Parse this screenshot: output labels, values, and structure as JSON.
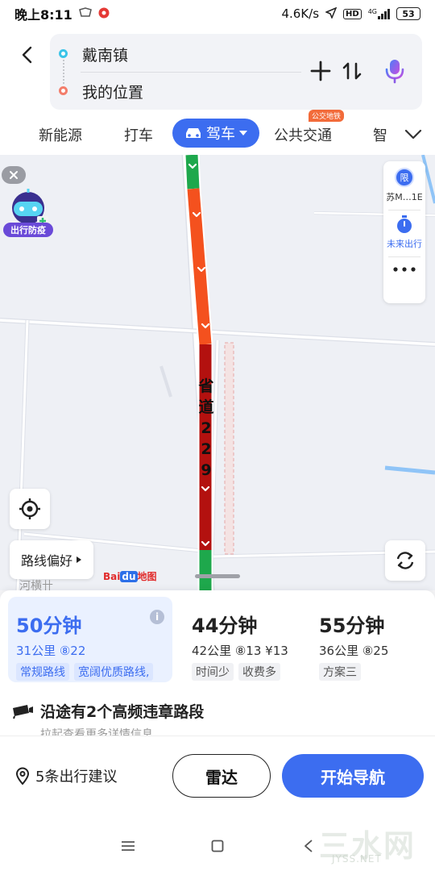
{
  "status_bar": {
    "time": "晚上8:11",
    "network_speed": "4.6K/s",
    "hd_badge": "HD",
    "network_type": "4G",
    "battery": "53"
  },
  "header": {
    "origin": "戴南镇",
    "destination": "我的位置",
    "icons": [
      "back-icon",
      "plus-icon",
      "swap-icon",
      "microphone-icon"
    ]
  },
  "tabs": {
    "new_energy": "新能源",
    "taxi": "打车",
    "drive": "驾车",
    "transit": "公共交通",
    "transit_badge": "公交地铁",
    "smart": "智"
  },
  "map": {
    "mascot_label": "出行防疫",
    "plate_label": "苏M…1E",
    "plate_icon_text": "限",
    "future_trip_label": "未来出行",
    "route_preference_label": "路线偏好",
    "road_name": [
      "省",
      "道",
      "2",
      "2",
      "9"
    ],
    "place_label": "河横卄",
    "logo_text_bai": "Bai",
    "logo_text_du": "du",
    "logo_text_map": "地图"
  },
  "routes": [
    {
      "time": "50分钟",
      "distance": "31公里 ⑧22",
      "tags": [
        "常规路线",
        "宽阔优质路线,"
      ],
      "selected": true
    },
    {
      "time": "44分钟",
      "distance": "42公里 ⑧13 ¥13",
      "tags": [
        "时间少",
        "收费多"
      ],
      "selected": false
    },
    {
      "time": "55分钟",
      "distance": "36公里 ⑧25",
      "tags": [
        "方案三"
      ],
      "selected": false
    }
  ],
  "alert": {
    "title": "沿途有2个高频违章路段",
    "subtitle": "拉起查看更多详情信息"
  },
  "actions": {
    "suggestions": "5条出行建议",
    "radar": "雷达",
    "start_navigation": "开始导航"
  },
  "watermark": {
    "main": "三水网",
    "sub": "JYSS.NET"
  },
  "colors": {
    "accent": "#3c6df0",
    "traffic_green": "#1ea84c",
    "traffic_orange": "#f4511e",
    "traffic_red": "#b3110f"
  }
}
